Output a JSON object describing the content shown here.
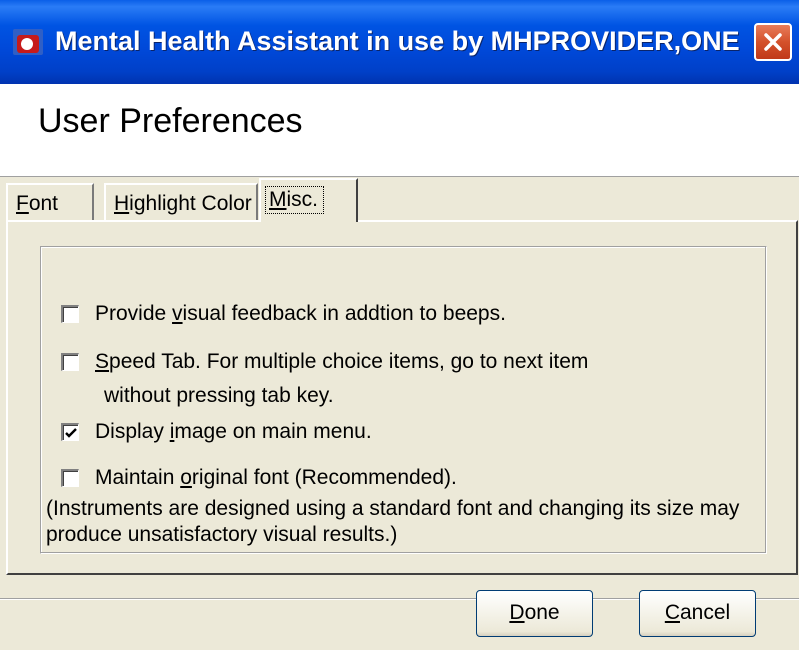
{
  "window": {
    "title": "Mental Health Assistant in use by MHPROVIDER,ONE",
    "icon": "mha-app-icon",
    "close_icon": "close-icon"
  },
  "header": {
    "title": "User Preferences"
  },
  "tabs": [
    {
      "label_pre": "",
      "mnemonic": "F",
      "label_post": "ont",
      "selected": false
    },
    {
      "label_pre": "",
      "mnemonic": "H",
      "label_post": "ighlight Color",
      "selected": false
    },
    {
      "label_pre": "",
      "mnemonic": "M",
      "label_post": "isc.",
      "selected": true
    }
  ],
  "options": [
    {
      "pre": "Provide ",
      "mnemonic": "v",
      "post": "isual feedback in addtion to beeps.",
      "checked": false
    },
    {
      "pre": "",
      "mnemonic": "S",
      "post": "peed Tab. For multiple choice items, go to next item",
      "line2": "without pressing tab key.",
      "checked": false
    },
    {
      "pre": "Display ",
      "mnemonic": "i",
      "post": "mage on main menu.",
      "checked": true
    },
    {
      "pre": "Maintain ",
      "mnemonic": "o",
      "post": "riginal font (Recommended).",
      "checked": false
    }
  ],
  "note": {
    "line1": "(Instruments are designed using a standard font and changing its size may",
    "line2": "produce unsatisfactory visual results.)"
  },
  "buttons": {
    "done": {
      "mnemonic": "D",
      "rest": "one"
    },
    "cancel": {
      "mnemonic": "C",
      "rest": "ancel"
    }
  },
  "colors": {
    "titlebar": "#0054e3",
    "dialog_bg": "#ece9d8",
    "close_button": "#d4512b"
  }
}
